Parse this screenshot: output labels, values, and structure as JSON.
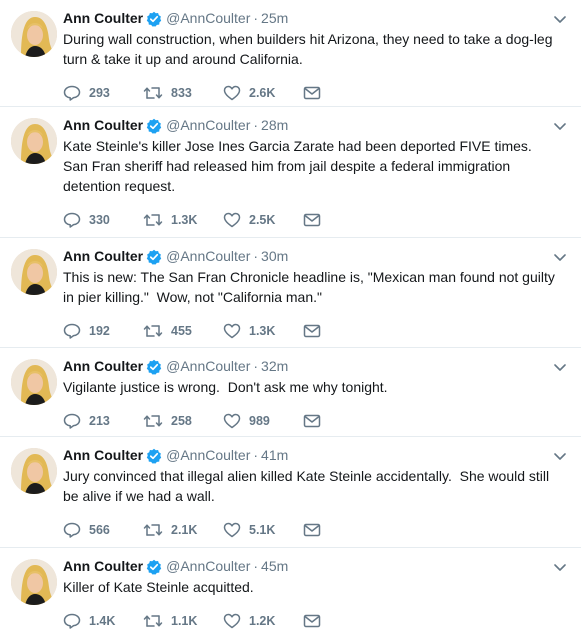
{
  "tweets": [
    {
      "name": "Ann Coulter",
      "handle": "@AnnCoulter",
      "time": "25m",
      "text": "During wall construction, when builders hit Arizona, they need to take a dog-leg turn & take it up and around California.",
      "replies": "293",
      "retweets": "833",
      "likes": "2.6K"
    },
    {
      "name": "Ann Coulter",
      "handle": "@AnnCoulter",
      "time": "28m",
      "text": "Kate Steinle's killer Jose Ines Garcia Zarate had been deported FIVE times. San Fran sheriff had released him from jail despite a federal immigration detention request.",
      "replies": "330",
      "retweets": "1.3K",
      "likes": "2.5K"
    },
    {
      "name": "Ann Coulter",
      "handle": "@AnnCoulter",
      "time": "30m",
      "text": "This is new: The San Fran Chronicle headline is, \"Mexican man found not guilty in pier killing.\"  Wow, not \"California man.\"",
      "replies": "192",
      "retweets": "455",
      "likes": "1.3K"
    },
    {
      "name": "Ann Coulter",
      "handle": "@AnnCoulter",
      "time": "32m",
      "text": "Vigilante justice is wrong.  Don't ask me why tonight.",
      "replies": "213",
      "retweets": "258",
      "likes": "989"
    },
    {
      "name": "Ann Coulter",
      "handle": "@AnnCoulter",
      "time": "41m",
      "text": "Jury convinced that illegal alien killed Kate Steinle accidentally.  She would still be alive if we had a wall.",
      "replies": "566",
      "retweets": "2.1K",
      "likes": "5.1K"
    },
    {
      "name": "Ann Coulter",
      "handle": "@AnnCoulter",
      "time": "45m",
      "text": "Killer of Kate Steinle acquitted.",
      "replies": "1.4K",
      "retweets": "1.1K",
      "likes": "1.2K"
    }
  ],
  "dot": "·",
  "icons": {
    "verified": "verified-badge-icon",
    "reply": "reply-icon",
    "retweet": "retweet-icon",
    "like": "heart-icon",
    "dm": "envelope-icon",
    "caret": "chevron-down-icon"
  },
  "colors": {
    "verified": "#1da1f2",
    "meta": "#657786",
    "text": "#14171a",
    "divider": "#e6ecf0"
  }
}
